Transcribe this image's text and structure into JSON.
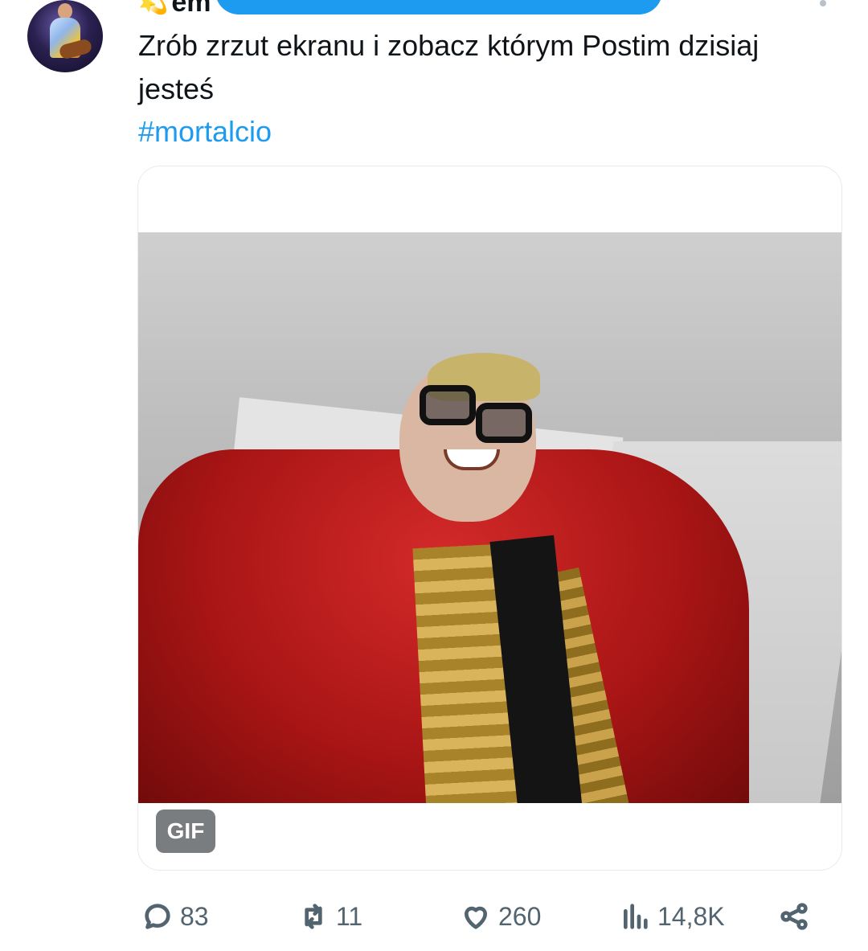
{
  "tweet": {
    "author_name": "em",
    "author_decor_icon": "sparkle-emoji",
    "text": "Zrób zrzut ekranu i zobacz którym Postim dzisiaj jesteś",
    "hashtag": "#mortalcio"
  },
  "media": {
    "badge": "GIF"
  },
  "actions": {
    "replies": "83",
    "retweets": "11",
    "likes": "260",
    "views": "14,8K"
  },
  "colors": {
    "link": "#1d9bf0",
    "muted": "#536471",
    "badge_bg": "#7a7d80"
  }
}
